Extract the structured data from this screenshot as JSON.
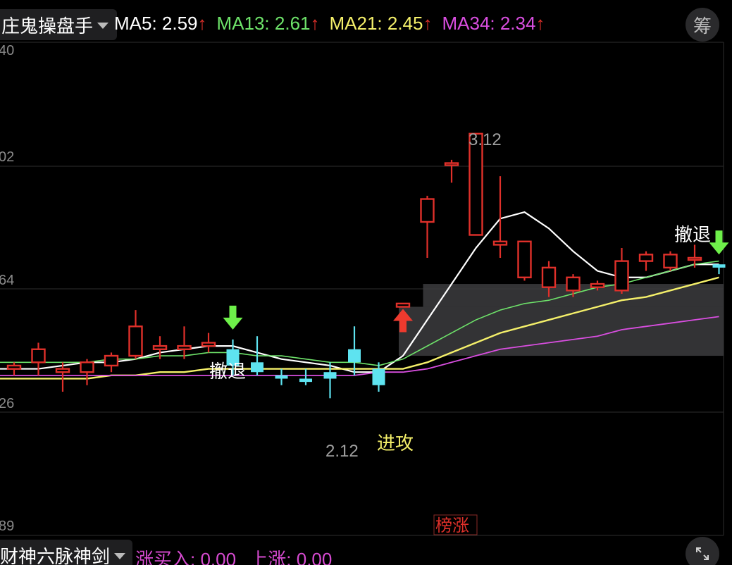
{
  "indicator": {
    "name": "庄鬼操盘手",
    "caret_icon": "chevron-down-icon"
  },
  "ma": [
    {
      "label": "MA5: 2.59",
      "color": "#ffffff"
    },
    {
      "label": "MA13: 2.61",
      "color": "#6ee36a"
    },
    {
      "label": "MA21: 2.45",
      "color": "#f5f06a"
    },
    {
      "label": "MA34: 2.34",
      "color": "#d94ee0"
    }
  ],
  "ma_arrow": "↑",
  "chip_button": "筹",
  "y_axis_labels": [
    "40",
    "02",
    "64",
    "26",
    "89"
  ],
  "labels": {
    "high": "3.12",
    "low": "2.12",
    "retreat_left": "撤退",
    "retreat_right": "撤退",
    "attack": "进攻",
    "rank_badge": "榜涨"
  },
  "footer": {
    "indicator_name": "财神六脉神剑",
    "stat_buy": "涨买入: 0.00",
    "stat_up": "上涨: 0.00",
    "expand_icon": "expand-icon"
  },
  "colors": {
    "up": "#e0302a",
    "down": "#5ee3f0",
    "ma5": "#ffffff",
    "ma13": "#6ee36a",
    "ma21": "#f5f06a",
    "ma34": "#d94ee0",
    "zone": "#3c3c3e",
    "signal_green": "#6ef04a",
    "signal_red": "#ee3a2e"
  },
  "chart_data": {
    "type": "candlestick",
    "y_tick_labels": [
      "40",
      "02",
      "64",
      "26",
      "89"
    ],
    "candles": [
      {
        "o": 2.4,
        "h": 2.42,
        "l": 2.38,
        "c": 2.41,
        "dir": "up"
      },
      {
        "o": 2.42,
        "h": 2.48,
        "l": 2.38,
        "c": 2.46,
        "dir": "up"
      },
      {
        "o": 2.39,
        "h": 2.42,
        "l": 2.33,
        "c": 2.4,
        "dir": "up"
      },
      {
        "o": 2.39,
        "h": 2.43,
        "l": 2.35,
        "c": 2.42,
        "dir": "up"
      },
      {
        "o": 2.41,
        "h": 2.45,
        "l": 2.39,
        "c": 2.44,
        "dir": "up"
      },
      {
        "o": 2.44,
        "h": 2.58,
        "l": 2.43,
        "c": 2.53,
        "dir": "up"
      },
      {
        "o": 2.46,
        "h": 2.5,
        "l": 2.43,
        "c": 2.47,
        "dir": "up"
      },
      {
        "o": 2.46,
        "h": 2.53,
        "l": 2.43,
        "c": 2.47,
        "dir": "up"
      },
      {
        "o": 2.47,
        "h": 2.51,
        "l": 2.45,
        "c": 2.48,
        "dir": "up"
      },
      {
        "o": 2.46,
        "h": 2.49,
        "l": 2.38,
        "c": 2.41,
        "dir": "down"
      },
      {
        "o": 2.42,
        "h": 2.5,
        "l": 2.38,
        "c": 2.39,
        "dir": "down"
      },
      {
        "o": 2.38,
        "h": 2.4,
        "l": 2.35,
        "c": 2.37,
        "dir": "down"
      },
      {
        "o": 2.37,
        "h": 2.4,
        "l": 2.35,
        "c": 2.36,
        "dir": "down"
      },
      {
        "o": 2.39,
        "h": 2.42,
        "l": 2.31,
        "c": 2.37,
        "dir": "down"
      },
      {
        "o": 2.46,
        "h": 2.53,
        "l": 2.38,
        "c": 2.42,
        "dir": "down"
      },
      {
        "o": 2.4,
        "h": 2.42,
        "l": 2.33,
        "c": 2.35,
        "dir": "down"
      },
      {
        "o": 2.59,
        "h": 2.6,
        "l": 2.59,
        "c": 2.6,
        "dir": "up"
      },
      {
        "o": 2.85,
        "h": 2.93,
        "l": 2.74,
        "c": 2.92,
        "dir": "up"
      },
      {
        "o": 3.03,
        "h": 3.04,
        "l": 2.97,
        "c": 3.03,
        "dir": "up"
      },
      {
        "o": 2.81,
        "h": 3.12,
        "l": 2.81,
        "c": 3.12,
        "dir": "up"
      },
      {
        "o": 2.78,
        "h": 2.99,
        "l": 2.74,
        "c": 2.79,
        "dir": "up"
      },
      {
        "o": 2.79,
        "h": 2.79,
        "l": 2.67,
        "c": 2.68,
        "dir": "up"
      },
      {
        "o": 2.71,
        "h": 2.73,
        "l": 2.62,
        "c": 2.65,
        "dir": "up"
      },
      {
        "o": 2.68,
        "h": 2.69,
        "l": 2.62,
        "c": 2.64,
        "dir": "up"
      },
      {
        "o": 2.66,
        "h": 2.67,
        "l": 2.64,
        "c": 2.65,
        "dir": "up"
      },
      {
        "o": 2.64,
        "h": 2.77,
        "l": 2.63,
        "c": 2.73,
        "dir": "up"
      },
      {
        "o": 2.73,
        "h": 2.76,
        "l": 2.7,
        "c": 2.75,
        "dir": "up"
      },
      {
        "o": 2.71,
        "h": 2.76,
        "l": 2.7,
        "c": 2.75,
        "dir": "up"
      },
      {
        "o": 2.74,
        "h": 2.78,
        "l": 2.71,
        "c": 2.74,
        "dir": "up"
      },
      {
        "o": 2.72,
        "h": 2.72,
        "l": 2.69,
        "c": 2.71,
        "dir": "down"
      }
    ],
    "series": [
      {
        "name": "MA5",
        "values": [
          2.4,
          2.4,
          2.41,
          2.42,
          2.42,
          2.43,
          2.45,
          2.46,
          2.47,
          2.47,
          2.45,
          2.43,
          2.42,
          2.41,
          2.39,
          2.39,
          2.44,
          2.55,
          2.66,
          2.77,
          2.86,
          2.88,
          2.83,
          2.76,
          2.7,
          2.68,
          2.68,
          2.7,
          2.72,
          2.72
        ]
      },
      {
        "name": "MA13",
        "values": [
          2.42,
          2.42,
          2.42,
          2.42,
          2.43,
          2.43,
          2.44,
          2.44,
          2.45,
          2.45,
          2.44,
          2.44,
          2.43,
          2.42,
          2.42,
          2.41,
          2.43,
          2.47,
          2.51,
          2.55,
          2.58,
          2.6,
          2.61,
          2.63,
          2.65,
          2.66,
          2.68,
          2.7,
          2.72,
          2.73
        ]
      },
      {
        "name": "MA21",
        "values": [
          2.37,
          2.37,
          2.37,
          2.37,
          2.38,
          2.38,
          2.39,
          2.39,
          2.4,
          2.4,
          2.4,
          2.4,
          2.4,
          2.4,
          2.4,
          2.4,
          2.4,
          2.42,
          2.45,
          2.48,
          2.51,
          2.53,
          2.55,
          2.57,
          2.59,
          2.61,
          2.62,
          2.64,
          2.66,
          2.68
        ]
      },
      {
        "name": "MA34",
        "values": [
          2.38,
          2.38,
          2.38,
          2.38,
          2.38,
          2.38,
          2.38,
          2.38,
          2.38,
          2.38,
          2.38,
          2.38,
          2.38,
          2.38,
          2.38,
          2.39,
          2.39,
          2.4,
          2.42,
          2.44,
          2.46,
          2.47,
          2.48,
          2.49,
          2.5,
          2.52,
          2.53,
          2.54,
          2.55,
          2.56
        ]
      }
    ],
    "zones": [
      {
        "from_index": 16,
        "low": 2.44,
        "high": 2.59
      },
      {
        "from_index": 17,
        "low": 2.59,
        "high": 2.66
      }
    ],
    "signals": [
      {
        "type": "sell",
        "index": 9,
        "label": "撤退"
      },
      {
        "type": "buy",
        "index": 16,
        "label": "进攻"
      },
      {
        "type": "sell",
        "index": 29,
        "label": "撤退"
      }
    ],
    "annotations": [
      {
        "index": 19,
        "price": 3.12,
        "text": "3.12"
      },
      {
        "index": 13,
        "price": 2.12,
        "text": "2.12"
      }
    ],
    "grid": true
  }
}
